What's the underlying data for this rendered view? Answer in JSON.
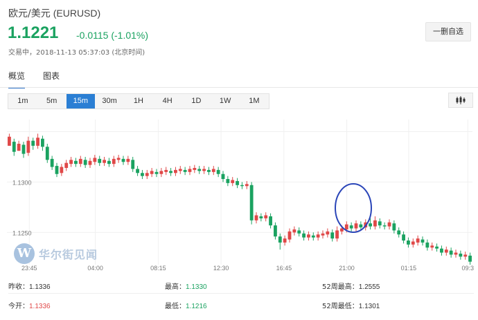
{
  "header": {
    "name": "欧元/美元",
    "code": "(EURUSD)",
    "price": "1.1221",
    "change": "-0.0115 (-1.01%)",
    "status": "交易中，2018-11-13 05:37:03 (北京时间)",
    "watch_button": "一删自选"
  },
  "tabs": [
    {
      "label": "概览",
      "active": true
    },
    {
      "label": "图表",
      "active": false
    }
  ],
  "intervals": [
    {
      "label": "1m",
      "active": false
    },
    {
      "label": "5m",
      "active": false
    },
    {
      "label": "15m",
      "active": true
    },
    {
      "label": "30m",
      "active": false
    },
    {
      "label": "1H",
      "active": false
    },
    {
      "label": "4H",
      "active": false
    },
    {
      "label": "1D",
      "active": false
    },
    {
      "label": "1W",
      "active": false
    },
    {
      "label": "1M",
      "active": false
    }
  ],
  "chart_type_icon": "candlestick-icon",
  "watermark": {
    "logo_letter": "W",
    "text": "华尔街见闻"
  },
  "colors": {
    "up": "#e04848",
    "down": "#1aa260",
    "accent": "#2b7fd4",
    "annotation": "#2a45b8"
  },
  "chart_data": {
    "type": "candlestick",
    "y_ticks": [
      "1.1300",
      "1.1250"
    ],
    "x_ticks": [
      "23:45",
      "04:00",
      "08:15",
      "12:30",
      "16:45",
      "21:00",
      "01:15",
      "09:3"
    ],
    "ylim": [
      1.1218,
      1.1362
    ],
    "grid": true,
    "annotation": "circle around 21:00 candles",
    "candles": [
      [
        1.1336,
        1.1345,
        1.134,
        1.1348
      ],
      [
        1.134,
        1.133,
        1.1343,
        1.1326
      ],
      [
        1.1331,
        1.1338,
        1.1334,
        1.1341
      ],
      [
        1.1337,
        1.1328,
        1.134,
        1.1324
      ],
      [
        1.1329,
        1.1341,
        1.1326,
        1.1345
      ],
      [
        1.1341,
        1.1336,
        1.1344,
        1.1332
      ],
      [
        1.1336,
        1.1344,
        1.1333,
        1.1348
      ],
      [
        1.1343,
        1.1335,
        1.1346,
        1.1331
      ],
      [
        1.1335,
        1.1322,
        1.1338,
        1.1319
      ],
      [
        1.1323,
        1.1315,
        1.1326,
        1.1312
      ],
      [
        1.1316,
        1.1308,
        1.1319,
        1.1305
      ],
      [
        1.1309,
        1.1315,
        1.1306,
        1.1318
      ],
      [
        1.1314,
        1.1319,
        1.1311,
        1.1322
      ],
      [
        1.1318,
        1.1322,
        1.1315,
        1.1325
      ],
      [
        1.1321,
        1.1318,
        1.1324,
        1.1315
      ],
      [
        1.1318,
        1.1323,
        1.1315,
        1.1326
      ],
      [
        1.1322,
        1.1317,
        1.1325,
        1.1314
      ],
      [
        1.1317,
        1.1321,
        1.1314,
        1.1324
      ],
      [
        1.132,
        1.1324,
        1.1317,
        1.1327
      ],
      [
        1.1323,
        1.1319,
        1.1326,
        1.1316
      ],
      [
        1.1319,
        1.1322,
        1.1316,
        1.1325
      ],
      [
        1.1321,
        1.1318,
        1.1324,
        1.1315
      ],
      [
        1.1318,
        1.1323,
        1.1315,
        1.1326
      ],
      [
        1.1322,
        1.1324,
        1.1319,
        1.1327
      ],
      [
        1.1323,
        1.132,
        1.1326,
        1.1317
      ],
      [
        1.132,
        1.1323,
        1.1317,
        1.1326
      ],
      [
        1.1322,
        1.1313,
        1.1325,
        1.131
      ],
      [
        1.1313,
        1.1309,
        1.1316,
        1.1306
      ],
      [
        1.1309,
        1.1306,
        1.1312,
        1.1303
      ],
      [
        1.1306,
        1.1309,
        1.1303,
        1.1312
      ],
      [
        1.1308,
        1.1311,
        1.1305,
        1.1314
      ],
      [
        1.131,
        1.1308,
        1.1313,
        1.1305
      ],
      [
        1.1308,
        1.1311,
        1.1305,
        1.1314
      ],
      [
        1.131,
        1.1312,
        1.1307,
        1.1315
      ],
      [
        1.1311,
        1.1309,
        1.1314,
        1.1306
      ],
      [
        1.1309,
        1.1312,
        1.1306,
        1.1315
      ],
      [
        1.1311,
        1.1313,
        1.1308,
        1.1316
      ],
      [
        1.1312,
        1.131,
        1.1315,
        1.1307
      ],
      [
        1.131,
        1.1313,
        1.1307,
        1.1316
      ],
      [
        1.1312,
        1.1314,
        1.1309,
        1.1317
      ],
      [
        1.1313,
        1.1311,
        1.1316,
        1.1308
      ],
      [
        1.1311,
        1.1313,
        1.1308,
        1.1316
      ],
      [
        1.1312,
        1.131,
        1.1315,
        1.1307
      ],
      [
        1.131,
        1.1313,
        1.1307,
        1.1316
      ],
      [
        1.1312,
        1.1308,
        1.1315,
        1.1305
      ],
      [
        1.1308,
        1.1303,
        1.1311,
        1.13
      ],
      [
        1.1303,
        1.1299,
        1.1306,
        1.1296
      ],
      [
        1.1299,
        1.1302,
        1.1296,
        1.1305
      ],
      [
        1.1301,
        1.1297,
        1.1304,
        1.1294
      ],
      [
        1.1297,
        1.1296,
        1.13,
        1.1293
      ],
      [
        1.1296,
        1.1298,
        1.1293,
        1.1301
      ],
      [
        1.1297,
        1.1262,
        1.13,
        1.1258
      ],
      [
        1.1262,
        1.1267,
        1.1259,
        1.127
      ],
      [
        1.1266,
        1.1264,
        1.1269,
        1.1261
      ],
      [
        1.1264,
        1.1267,
        1.1261,
        1.127
      ],
      [
        1.1266,
        1.1257,
        1.1269,
        1.1254
      ],
      [
        1.1257,
        1.1246,
        1.126,
        1.1243
      ],
      [
        1.1246,
        1.124,
        1.1249,
        1.1233
      ],
      [
        1.124,
        1.1244,
        1.1237,
        1.1247
      ],
      [
        1.1243,
        1.1251,
        1.124,
        1.1254
      ],
      [
        1.125,
        1.1253,
        1.1247,
        1.1256
      ],
      [
        1.1252,
        1.1249,
        1.1255,
        1.1246
      ],
      [
        1.1249,
        1.1245,
        1.1252,
        1.1242
      ],
      [
        1.1245,
        1.1248,
        1.1242,
        1.1251
      ],
      [
        1.1247,
        1.1245,
        1.125,
        1.1242
      ],
      [
        1.1245,
        1.1248,
        1.1242,
        1.1251
      ],
      [
        1.1247,
        1.1249,
        1.1244,
        1.1252
      ],
      [
        1.1248,
        1.1251,
        1.1245,
        1.1254
      ],
      [
        1.125,
        1.1244,
        1.1253,
        1.1241
      ],
      [
        1.1244,
        1.1252,
        1.1241,
        1.1256
      ],
      [
        1.1251,
        1.1254,
        1.1248,
        1.1257
      ],
      [
        1.1253,
        1.1258,
        1.125,
        1.1261
      ],
      [
        1.1257,
        1.1254,
        1.126,
        1.1251
      ],
      [
        1.1254,
        1.1259,
        1.1251,
        1.1262
      ],
      [
        1.1258,
        1.1255,
        1.1261,
        1.1252
      ],
      [
        1.1255,
        1.126,
        1.1252,
        1.1263
      ],
      [
        1.1259,
        1.1256,
        1.1264,
        1.1253
      ],
      [
        1.1256,
        1.1262,
        1.1253,
        1.1266
      ],
      [
        1.1261,
        1.1257,
        1.1264,
        1.1254
      ],
      [
        1.1257,
        1.1256,
        1.126,
        1.1253
      ],
      [
        1.1256,
        1.126,
        1.1253,
        1.1263
      ],
      [
        1.1259,
        1.1252,
        1.1262,
        1.1249
      ],
      [
        1.1252,
        1.1248,
        1.1255,
        1.1245
      ],
      [
        1.1248,
        1.1242,
        1.1251,
        1.1239
      ],
      [
        1.1242,
        1.1238,
        1.1245,
        1.1235
      ],
      [
        1.1238,
        1.1241,
        1.1235,
        1.1244
      ],
      [
        1.124,
        1.1244,
        1.1237,
        1.1247
      ],
      [
        1.1243,
        1.124,
        1.1246,
        1.1237
      ],
      [
        1.124,
        1.1235,
        1.1243,
        1.1232
      ],
      [
        1.1235,
        1.1237,
        1.1232,
        1.124
      ],
      [
        1.1236,
        1.1234,
        1.1239,
        1.1231
      ],
      [
        1.1234,
        1.123,
        1.1237,
        1.1227
      ],
      [
        1.123,
        1.1233,
        1.1227,
        1.1236
      ],
      [
        1.1232,
        1.1228,
        1.1235,
        1.1225
      ],
      [
        1.1228,
        1.123,
        1.1225,
        1.1233
      ],
      [
        1.1229,
        1.1226,
        1.1232,
        1.1223
      ],
      [
        1.1226,
        1.1228,
        1.1223,
        1.1231
      ],
      [
        1.1227,
        1.1221,
        1.123,
        1.1218
      ]
    ]
  },
  "stats": {
    "prev_close": {
      "label": "昨收：",
      "value": "1.1336"
    },
    "open": {
      "label": "今开：",
      "value": "1.1336"
    },
    "high": {
      "label": "最高：",
      "value": "1.1330"
    },
    "low": {
      "label": "最低：",
      "value": "1.1216"
    },
    "high_52w": {
      "label": "52周最高：",
      "value": "1.2555"
    },
    "low_52w": {
      "label": "52周最低：",
      "value": "1.1301"
    }
  }
}
